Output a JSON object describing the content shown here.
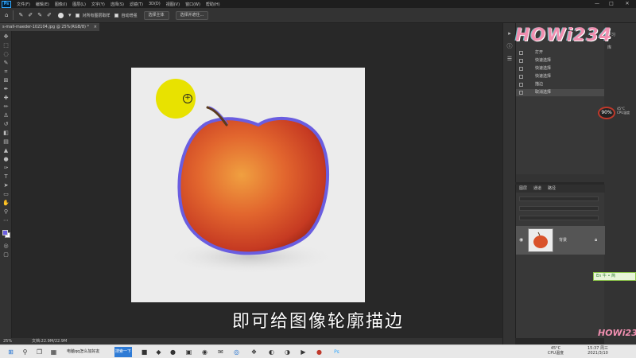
{
  "menu": {
    "app_logo": "Ps",
    "items": [
      "文件(F)",
      "编辑(E)",
      "图像(I)",
      "图层(L)",
      "文字(Y)",
      "选择(S)",
      "滤镜(T)",
      "3D(D)",
      "视图(V)",
      "窗口(W)",
      "帮助(H)"
    ],
    "window_controls": [
      "—",
      "□",
      "✕"
    ]
  },
  "options": {
    "sample_all_layers": "对所有图层取样",
    "auto_enhance": "自动增强",
    "select_subject": "选择主体",
    "select_and_mask": "选择并遮住..."
  },
  "document": {
    "tab_title": "s-mall-maeder-102104.jpg @ 25%(RGB/8) *",
    "tab_close": "×"
  },
  "subtitle": "即可给图像轮廓描边",
  "status": {
    "zoom": "25%",
    "doc_size": "文档:22.9M/22.9M"
  },
  "history": {
    "items": [
      {
        "label": "打开",
        "active": false
      },
      {
        "label": "快速选择",
        "active": false
      },
      {
        "label": "快速选择",
        "active": false
      },
      {
        "label": "快速选择",
        "active": false
      },
      {
        "label": "描边",
        "active": false
      },
      {
        "label": "取消选择",
        "active": true
      }
    ]
  },
  "right_sidebar": {
    "learn": "学习",
    "library": "库"
  },
  "layers": {
    "tabs": [
      "图层",
      "通道",
      "路径"
    ],
    "layer_name": "背景"
  },
  "watermark": {
    "main": "HOWi234",
    "small": "HOWi234"
  },
  "cpu": {
    "value": "90",
    "unit": "%",
    "temp": "45°C",
    "label": "CPU温度"
  },
  "ime": {
    "text": "En 牛 • 简"
  },
  "taskbar": {
    "task_text": "电脑qq怎么加好友",
    "search_button": "搜索一下",
    "tray_temp": "45°C",
    "tray_cpu": "CPU温度",
    "time": "15:37 周三",
    "date": "2021/3/10"
  },
  "colors": {
    "selection_outline": "#6a5de0",
    "cursor_yellow": "#e8e200",
    "accent": "#31a8ff"
  },
  "icons": {
    "toolbar": [
      "move-icon",
      "marquee-icon",
      "lasso-icon",
      "quick-select-icon",
      "crop-icon",
      "frame-icon",
      "eyedropper-icon",
      "healing-icon",
      "brush-icon",
      "stamp-icon",
      "history-brush-icon",
      "eraser-icon",
      "gradient-icon",
      "blur-icon",
      "dodge-icon",
      "pen-icon",
      "type-icon",
      "path-select-icon",
      "shape-icon",
      "hand-icon",
      "zoom-icon",
      "more-icon"
    ]
  }
}
